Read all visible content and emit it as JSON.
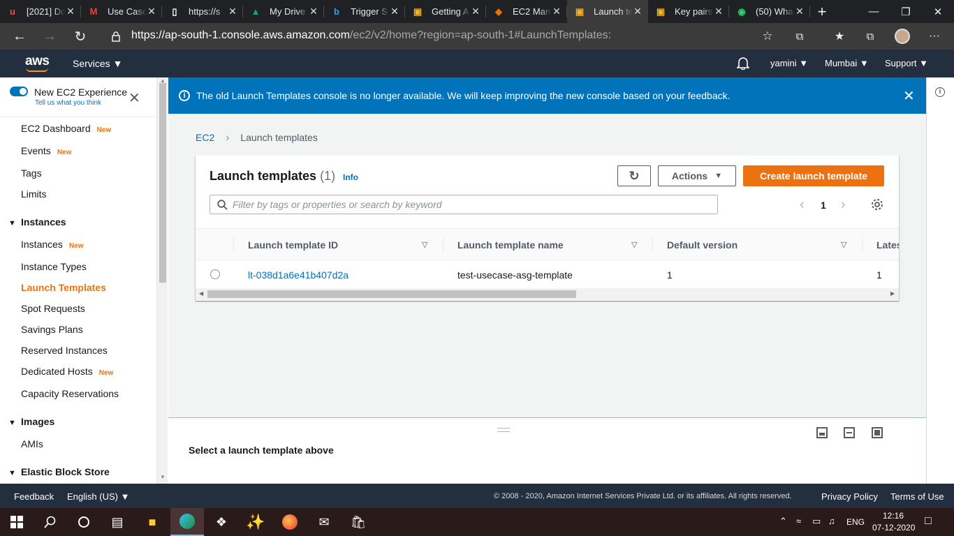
{
  "browser": {
    "tabs": [
      {
        "icon": "udemy-icon",
        "label": "[2021] Do",
        "color": "#ec5252"
      },
      {
        "icon": "gmail-icon",
        "label": "Use Case",
        "color": "#ea4335"
      },
      {
        "icon": "page-icon",
        "label": "https://s",
        "color": "#ffffff"
      },
      {
        "icon": "google-drive-icon",
        "label": "My Drive",
        "color": "#1fa463"
      },
      {
        "icon": "bing-icon",
        "label": "Trigger S",
        "color": "#2aa0f0"
      },
      {
        "icon": "aws-box-icon",
        "label": "Getting A",
        "color": "#f0b429"
      },
      {
        "icon": "aws-ec2-icon",
        "label": "EC2 Man",
        "color": "#ed7100"
      },
      {
        "icon": "aws-box-icon",
        "label": "Launch te",
        "color": "#f0b429",
        "active": true
      },
      {
        "icon": "aws-box-icon",
        "label": "Key pairs",
        "color": "#f0b429"
      },
      {
        "icon": "whatsapp-icon",
        "label": "(50) Wha",
        "color": "#25d366"
      }
    ],
    "url_host": "https://ap-south-1.console.aws.amazon.com",
    "url_path": "/ec2/v2/home?region=ap-south-1#LaunchTemplates:"
  },
  "aws_header": {
    "logo": "aws",
    "services": "Services",
    "user": "yamini",
    "region": "Mumbai",
    "support": "Support"
  },
  "sidebar": {
    "experience_title": "New EC2 Experience",
    "experience_sub": "Tell us what you think",
    "new_badge": "New",
    "items": [
      {
        "label": "EC2 Dashboard",
        "new": true
      },
      {
        "label": "Events",
        "new": true
      },
      {
        "label": "Tags"
      },
      {
        "label": "Limits"
      }
    ],
    "sections": [
      {
        "title": "Instances",
        "items": [
          {
            "label": "Instances",
            "new": true
          },
          {
            "label": "Instance Types"
          },
          {
            "label": "Launch Templates",
            "active": true
          },
          {
            "label": "Spot Requests"
          },
          {
            "label": "Savings Plans"
          },
          {
            "label": "Reserved Instances"
          },
          {
            "label": "Dedicated Hosts",
            "new": true
          },
          {
            "label": "Capacity Reservations"
          }
        ]
      },
      {
        "title": "Images",
        "items": [
          {
            "label": "AMIs"
          }
        ]
      },
      {
        "title": "Elastic Block Store",
        "items": []
      }
    ]
  },
  "banner": {
    "text": "The old Launch Templates console is no longer available. We will keep improving the new console based on your feedback."
  },
  "breadcrumb": {
    "root": "EC2",
    "current": "Launch templates"
  },
  "table": {
    "title": "Launch templates",
    "count": "(1)",
    "info": "Info",
    "actions": "Actions",
    "create": "Create launch template",
    "filter_placeholder": "Filter by tags or properties or search by keyword",
    "page": "1",
    "columns": [
      "Launch template ID",
      "Launch template name",
      "Default version",
      "Lates"
    ],
    "rows": [
      {
        "id": "lt-038d1a6e41b407d2a",
        "name": "test-usecase-asg-template",
        "default_version": "1",
        "latest_version": "1"
      }
    ]
  },
  "split_panel": {
    "text": "Select a launch template above"
  },
  "footer": {
    "feedback": "Feedback",
    "language": "English (US)",
    "copyright": "© 2008 - 2020, Amazon Internet Services Private Ltd. or its affiliates. All rights reserved.",
    "privacy": "Privacy Policy",
    "terms": "Terms of Use"
  },
  "taskbar": {
    "lang": "ENG",
    "time": "12:16",
    "date": "07-12-2020"
  },
  "colors": {
    "aws_orange": "#ec7211",
    "banner_blue": "#0073bb",
    "link_blue": "#0073bb",
    "header_navy": "#232f3e"
  }
}
